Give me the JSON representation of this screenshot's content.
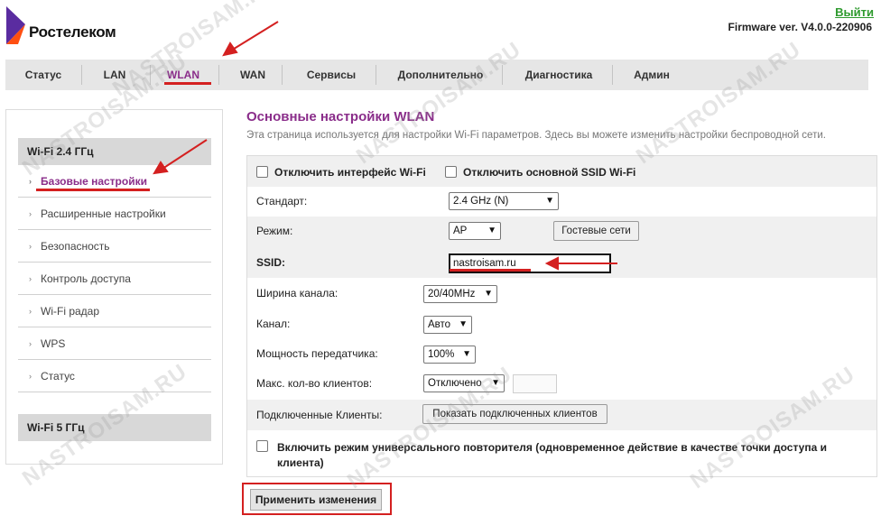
{
  "header": {
    "brand": "Ростелеком",
    "logout": "Выйти",
    "firmware": "Firmware ver. V4.0.0-220906"
  },
  "nav": {
    "tabs": [
      {
        "label": "Статус"
      },
      {
        "label": "LAN"
      },
      {
        "label": "WLAN",
        "active": true
      },
      {
        "label": "WAN"
      },
      {
        "label": "Сервисы"
      },
      {
        "label": "Дополнительно"
      },
      {
        "label": "Диагностика"
      },
      {
        "label": "Админ"
      }
    ]
  },
  "sidebar": {
    "section_24": "Wi-Fi 2.4 ГГц",
    "items": [
      {
        "label": "Базовые настройки",
        "active": true
      },
      {
        "label": "Расширенные настройки"
      },
      {
        "label": "Безопасность"
      },
      {
        "label": "Контроль доступа"
      },
      {
        "label": "Wi-Fi радар"
      },
      {
        "label": "WPS"
      },
      {
        "label": "Статус"
      }
    ],
    "section_5": "Wi-Fi 5 ГГц"
  },
  "main": {
    "title": "Основные настройки WLAN",
    "description": "Эта страница используется для настройки Wi-Fi параметров. Здесь вы можете изменить настройки беспроводной сети.",
    "disable_iface": "Отключить интерфейс Wi-Fi",
    "disable_ssid": "Отключить основной SSID Wi-Fi",
    "standard_label": "Стандарт:",
    "standard_value": "2.4 GHz (N)",
    "mode_label": "Режим:",
    "mode_value": "AP",
    "guest_btn": "Гостевые сети",
    "ssid_label": "SSID:",
    "ssid_value": "nastroisam.ru",
    "bandwidth_label": "Ширина канала:",
    "bandwidth_value": "20/40MHz",
    "channel_label": "Канал:",
    "channel_value": "Авто",
    "power_label": "Мощность передатчика:",
    "power_value": "100%",
    "max_clients_label": "Макс. кол-во клиентов:",
    "max_clients_value": "Отключено",
    "connected_label": "Подключенные Клиенты:",
    "show_clients_btn": "Показать подключенных клиентов",
    "repeater_label": "Включить режим универсального повторителя (одновременное действие в качестве точки доступа и клиента)",
    "apply_btn": "Применить изменения"
  },
  "watermark": "NASTROISAM.RU",
  "colors": {
    "accent": "#8a2d8a",
    "annotation": "#d42020",
    "logout": "#2e9a2e"
  }
}
